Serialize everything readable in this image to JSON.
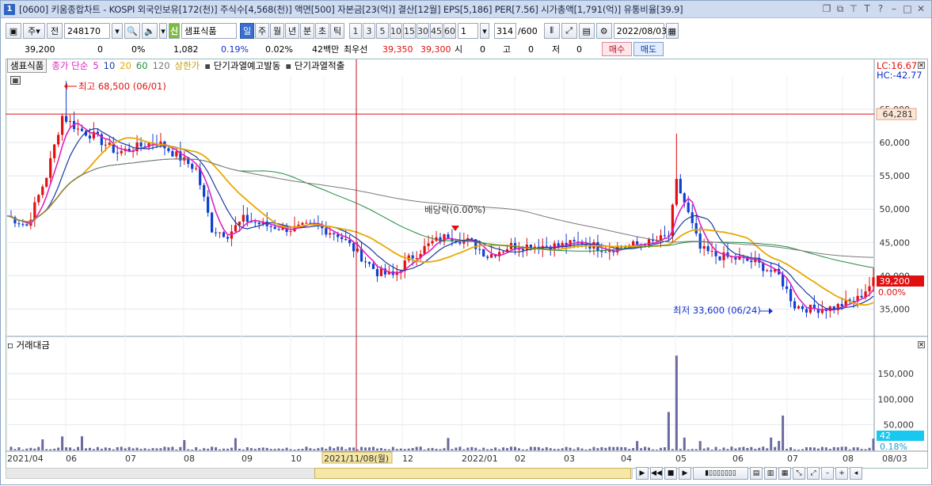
{
  "title": {
    "badge": "1",
    "text": "[0600] 키움종합차트 - KOSPI 외국인보유[172(천)] 주식수[4,568(천)] 액면[500] 자본금[23(억)] 결산[12월] EPS[5,186] PER[7.56] 시가총액[1,791(억)] 유통비율[39.9]"
  },
  "toolbar": {
    "market": "주",
    "prev": "전",
    "code": "248170",
    "stock_name": "샘표식품",
    "stock_flag": "신",
    "periods": [
      "일",
      "주",
      "월",
      "년",
      "분",
      "초",
      "틱"
    ],
    "active_period": "일",
    "intervals": [
      "1",
      "3",
      "5",
      "10",
      "15",
      "30",
      "45",
      "60"
    ],
    "interval_value": "1",
    "count": "314",
    "count_max": "/600",
    "date": "2022/08/03"
  },
  "info": {
    "price": "39,200",
    "change": "0",
    "change_pct": "0%",
    "volume": "1,082",
    "vol_ratio": "0.19%",
    "turnover": "0.02%",
    "amount": "42백만",
    "best_label": "최우선",
    "ask": "39,350",
    "bid": "39,300",
    "open_label": "시",
    "open": "0",
    "high_label": "고",
    "high": "0",
    "low_label": "저",
    "low": "0",
    "buy": "매수",
    "sell": "매도"
  },
  "legend": {
    "stock": "샘표식품",
    "ma_label": "종가 단순",
    "ma": [
      "5",
      "10",
      "20",
      "60",
      "120"
    ],
    "upper": "상한가",
    "warn1": "단기과열예고발동",
    "warn2": "단기과열적출"
  },
  "colors": {
    "ma5": "#e020c0",
    "ma10": "#1a3aa0",
    "ma20": "#e8a800",
    "ma60": "#1e8e3e",
    "ma120": "#7a7a7a",
    "up": "#e01010",
    "down": "#1040d0",
    "price_tag": "#e01010",
    "vol_bar": "#6a6aa0"
  },
  "chart_data": {
    "type": "candlestick",
    "price_axis": {
      "ticks": [
        "35,000",
        "40,000",
        "45,000",
        "50,000",
        "55,000",
        "60,000",
        "65,000"
      ],
      "ylim": [
        31000,
        70000
      ]
    },
    "volume_axis": {
      "ticks": [
        "50,000",
        "100,000",
        "150,000"
      ],
      "ylim": [
        0,
        190000
      ]
    },
    "x_ticks": [
      "2021/04",
      "06",
      "07",
      "08",
      "09",
      "10",
      "2021/11/08(월)",
      "12",
      "2022/01",
      "02",
      "03",
      "04",
      "05",
      "06",
      "07",
      "08",
      "08/03"
    ],
    "close_path": [
      [
        0,
        49000
      ],
      [
        5,
        47500
      ],
      [
        10,
        55000
      ],
      [
        14,
        64000
      ],
      [
        18,
        62000
      ],
      [
        22,
        61000
      ],
      [
        28,
        58500
      ],
      [
        34,
        59500
      ],
      [
        38,
        60200
      ],
      [
        42,
        58500
      ],
      [
        48,
        56000
      ],
      [
        52,
        47000
      ],
      [
        56,
        46200
      ],
      [
        60,
        48500
      ],
      [
        66,
        47500
      ],
      [
        72,
        47000
      ],
      [
        78,
        47500
      ],
      [
        84,
        46200
      ],
      [
        88,
        44000
      ],
      [
        94,
        40500
      ],
      [
        98,
        40000
      ],
      [
        102,
        42500
      ],
      [
        108,
        45000
      ],
      [
        112,
        46000
      ],
      [
        118,
        45000
      ],
      [
        122,
        43000
      ],
      [
        128,
        44500
      ],
      [
        134,
        44500
      ],
      [
        140,
        44500
      ],
      [
        146,
        45000
      ],
      [
        152,
        44000
      ],
      [
        158,
        44500
      ],
      [
        164,
        45000
      ],
      [
        168,
        46000
      ],
      [
        170,
        54000
      ],
      [
        172,
        51000
      ],
      [
        176,
        44000
      ],
      [
        180,
        43000
      ],
      [
        186,
        42500
      ],
      [
        190,
        42000
      ],
      [
        196,
        40000
      ],
      [
        200,
        35500
      ],
      [
        204,
        35000
      ],
      [
        210,
        35200
      ],
      [
        216,
        36500
      ],
      [
        220,
        39200
      ]
    ],
    "annotations": {
      "high": "최고 68,500 (06/01)",
      "low": "최저 33,600 (06/24)",
      "dividend": "배당락(0.00%)",
      "hline_value": "64,281",
      "last_price": "39,200",
      "last_pct": "0.00%",
      "lc": "LC:16.67",
      "hc": "HC:-42.77",
      "vol_last": "42",
      "vol_pct": "0.18%"
    },
    "volume_label": "거래대금"
  }
}
